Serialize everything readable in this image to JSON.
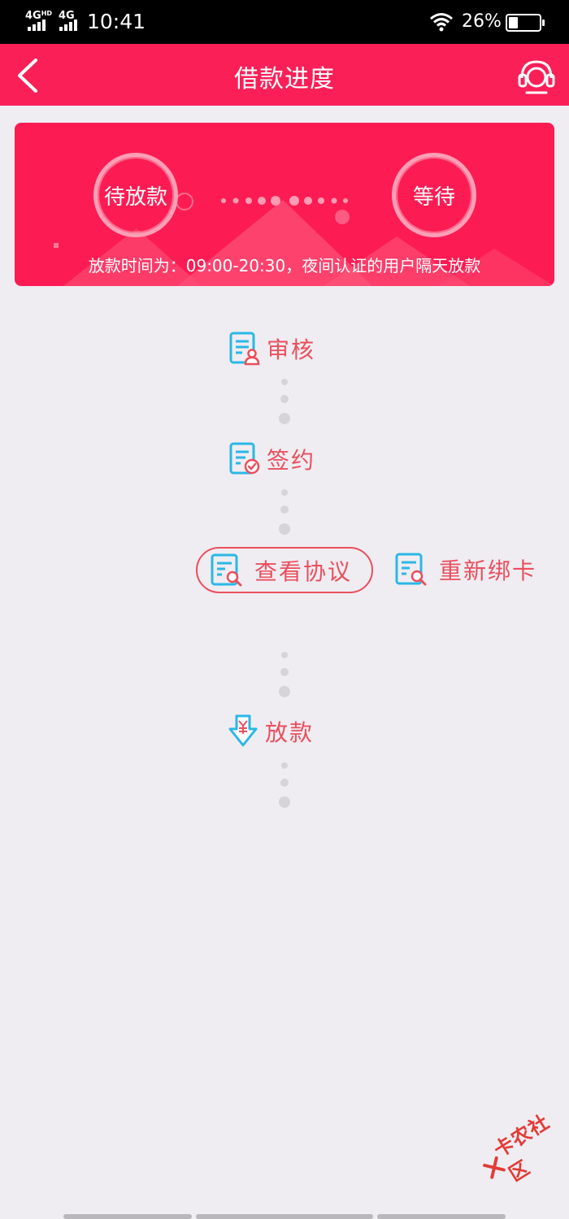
{
  "status_bar": {
    "signal_1": "4G",
    "signal_1_suffix": "HD",
    "signal_2": "4G",
    "time": "10:41",
    "battery_percent": "26%",
    "battery_level": 0.26
  },
  "nav": {
    "title": "借款进度",
    "back_icon": "chevron-left-icon",
    "service_icon": "customer-service-headset-icon"
  },
  "banner": {
    "status_left": "待放款",
    "status_right": "等待",
    "notice": "放款时间为：09:00-20:30，夜间认证的用户隔天放款"
  },
  "steps": [
    {
      "label": "审核",
      "icon": "review-document-icon"
    },
    {
      "label": "签约",
      "icon": "sign-document-check-icon"
    },
    {
      "label": "放款",
      "icon": "yuan-download-icon"
    }
  ],
  "actions": {
    "view_agreement": "查看协议",
    "rebind_card": "重新绑卡"
  },
  "watermark": {
    "text": "卡农社区"
  },
  "colors": {
    "brand_red": "#fb1f57",
    "step_text": "#ea4f5d",
    "icon_blue": "#2bb7e6",
    "background": "#efedf2"
  }
}
